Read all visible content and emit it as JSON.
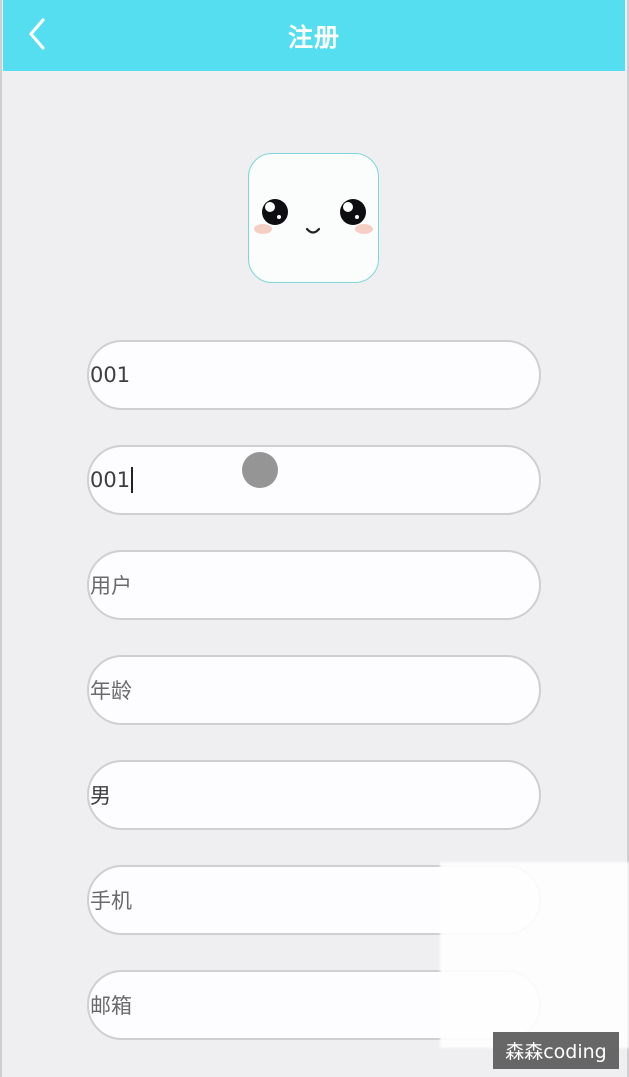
{
  "header": {
    "title": "注册",
    "back_icon": "chevron-left-icon",
    "color": "#55def0"
  },
  "avatar": {
    "icon": "cute-face-icon"
  },
  "form": {
    "account": {
      "value": "001"
    },
    "password": {
      "value": "001"
    },
    "username": {
      "placeholder": "用户"
    },
    "age": {
      "placeholder": "年龄"
    },
    "gender": {
      "value": "男"
    },
    "phone": {
      "placeholder": "手机"
    },
    "email": {
      "placeholder": "邮箱"
    }
  },
  "watermark": {
    "text": "森森coding"
  }
}
